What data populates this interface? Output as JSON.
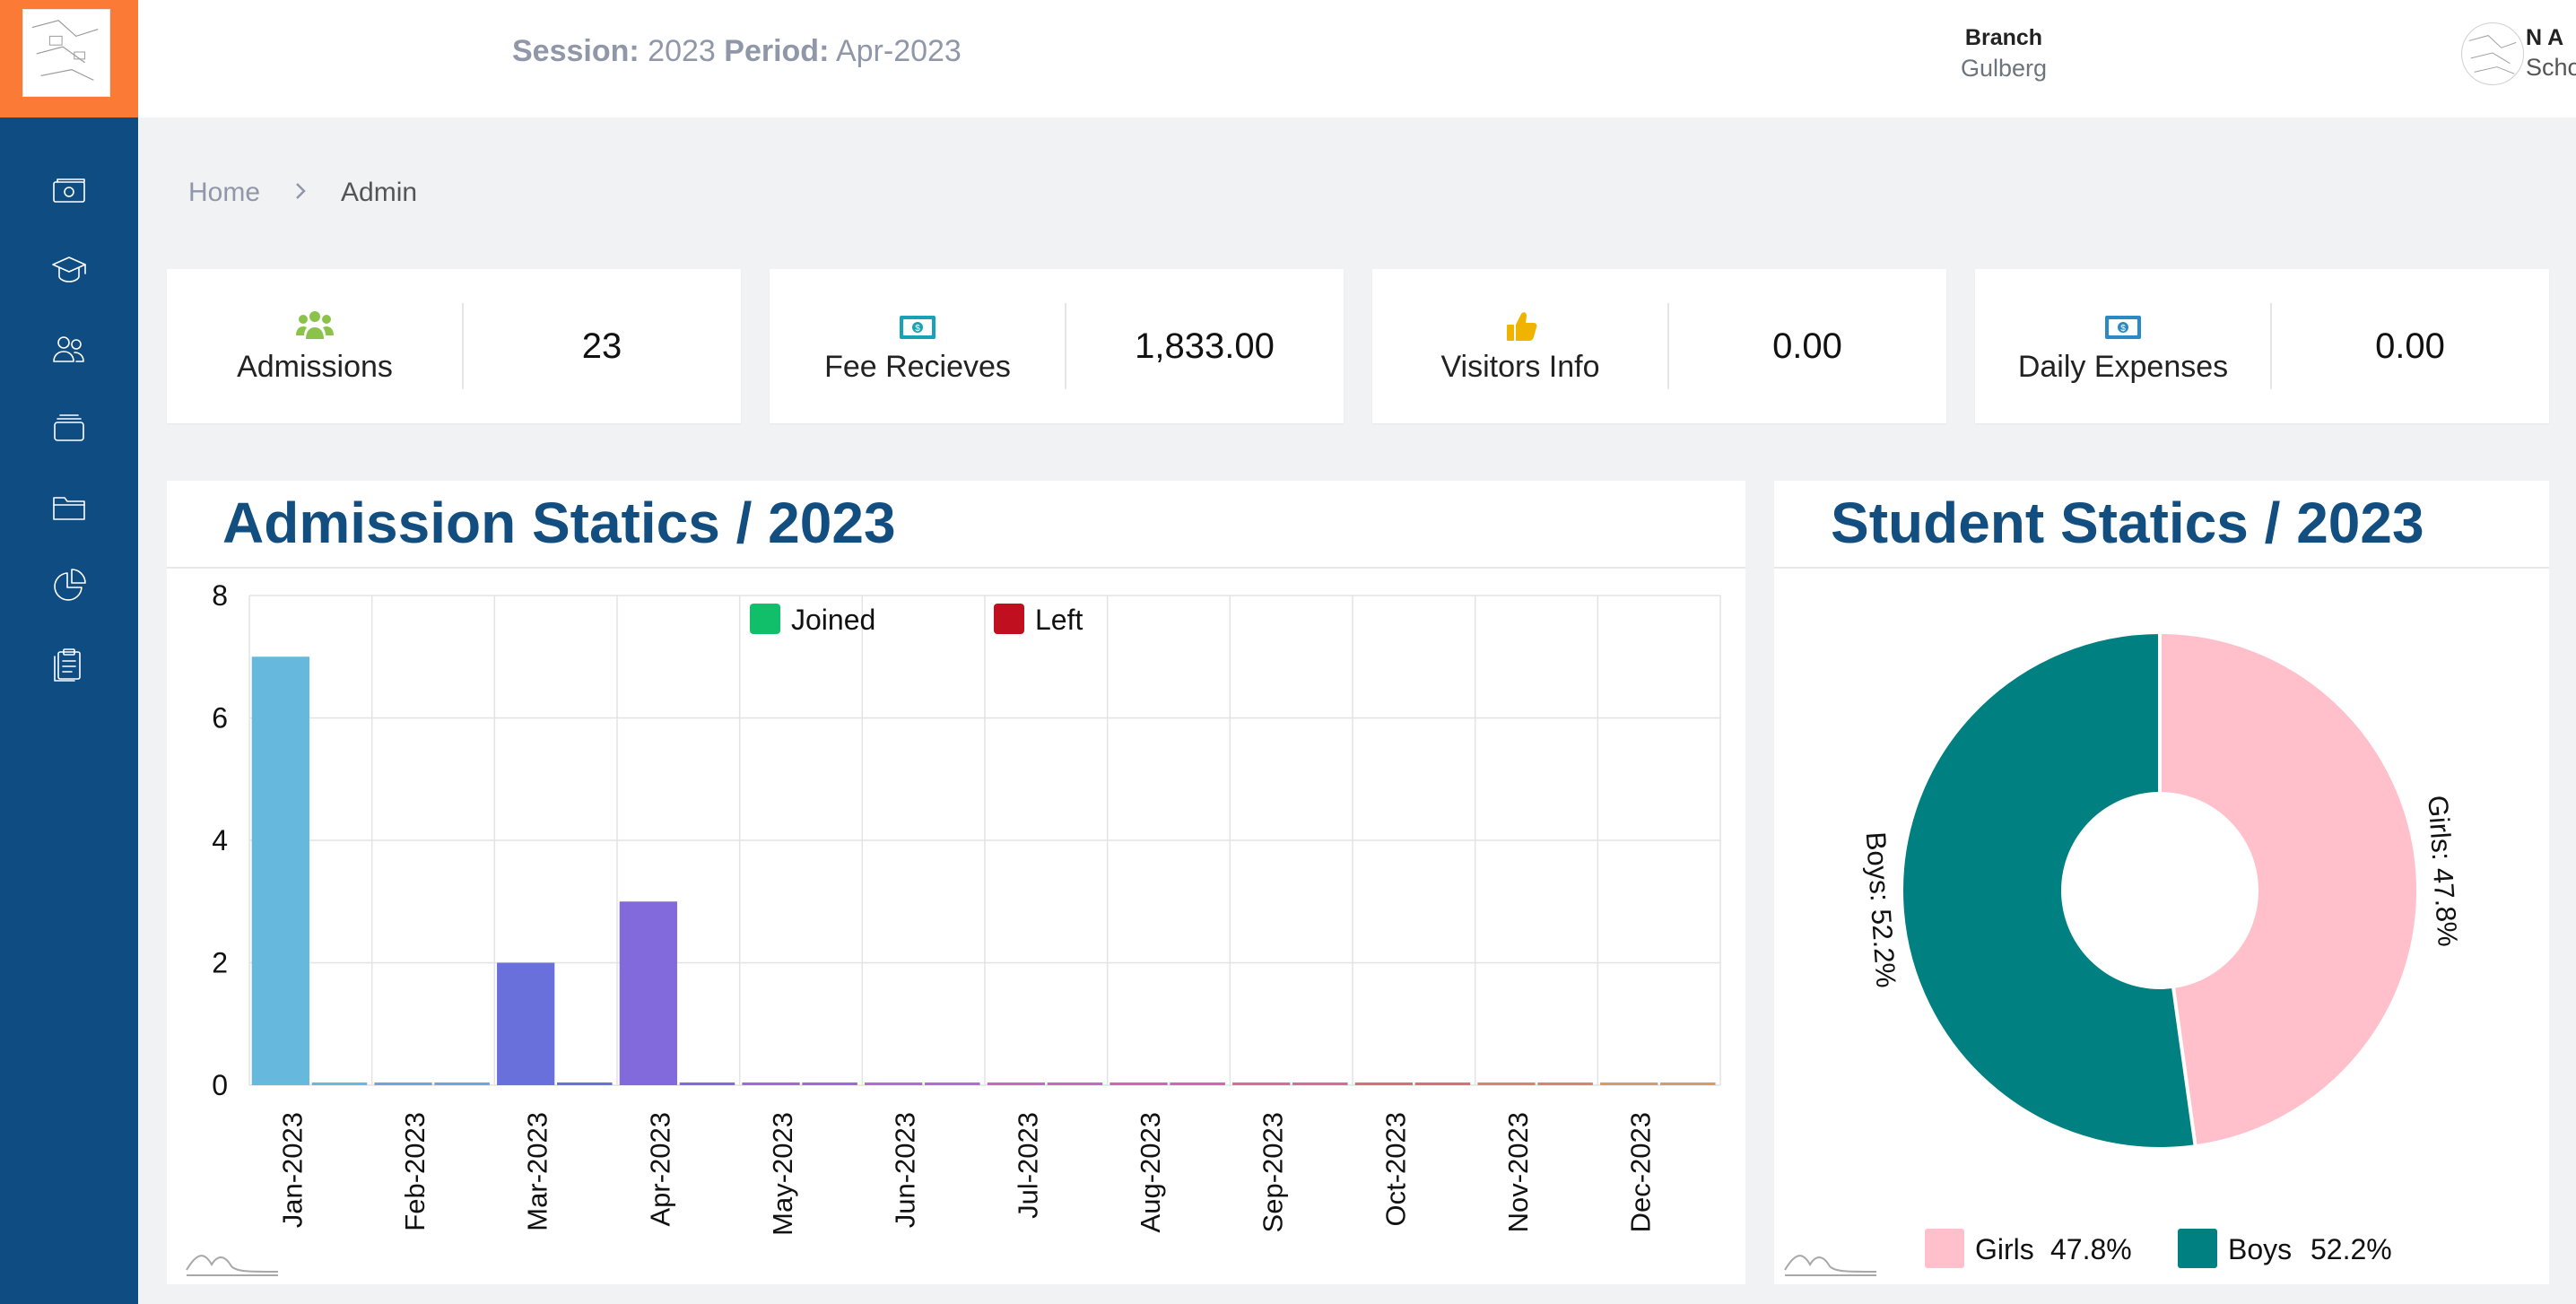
{
  "header": {
    "session_label": "Session:",
    "session_value": "2023",
    "period_label": "Period:",
    "period_value": "Apr-2023",
    "branch_label": "Branch",
    "branch_value": "Gulberg",
    "user_name": "N A",
    "user_role": "School Admin"
  },
  "sidebar": {
    "items": [
      {
        "icon": "money-icon"
      },
      {
        "icon": "graduation-cap-icon"
      },
      {
        "icon": "users-icon"
      },
      {
        "icon": "layers-icon"
      },
      {
        "icon": "folder-icon"
      },
      {
        "icon": "pie-chart-icon"
      },
      {
        "icon": "clipboard-icon"
      }
    ]
  },
  "breadcrumb": {
    "home": "Home",
    "current": "Admin"
  },
  "cards": [
    {
      "label": "Admissions",
      "value": "23",
      "icon": "users-icon",
      "color": "#8bc34a"
    },
    {
      "label": "Fee Recieves",
      "value": "1,833.00",
      "icon": "money-icon",
      "color": "#17a2b8"
    },
    {
      "label": "Visitors Info",
      "value": "0.00",
      "icon": "thumbs-up-icon",
      "color": "#f0b400"
    },
    {
      "label": "Daily Expenses",
      "value": "0.00",
      "icon": "money-icon",
      "color": "#2b8ac6"
    }
  ],
  "admission_chart": {
    "title": "Admission Statics / 2023"
  },
  "student_chart": {
    "title": "Student Statics / 2023"
  },
  "chart_data": [
    {
      "type": "bar",
      "title": "Admission Statics / 2023",
      "categories": [
        "Jan-2023",
        "Feb-2023",
        "Mar-2023",
        "Apr-2023",
        "May-2023",
        "Jun-2023",
        "Jul-2023",
        "Aug-2023",
        "Sep-2023",
        "Oct-2023",
        "Nov-2023",
        "Dec-2023"
      ],
      "series": [
        {
          "name": "Joined",
          "values": [
            7,
            0,
            2,
            3,
            0,
            0,
            0,
            0,
            0,
            0,
            0,
            0
          ],
          "color": "#11bf6a"
        },
        {
          "name": "Left",
          "values": [
            0,
            0,
            0,
            0,
            0,
            0,
            0,
            0,
            0,
            0,
            0,
            0
          ],
          "color": "#c0101f"
        }
      ],
      "bar_colors": [
        "#66b8dc",
        "#67a6e0",
        "#6970dc",
        "#8269dc",
        "#9c6bd9",
        "#b26ad6",
        "#c867c8",
        "#d166ae",
        "#d86a98",
        "#d86e7c",
        "#d9836e",
        "#d69b6a"
      ],
      "yticks": [
        0,
        2,
        4,
        6,
        8
      ],
      "ylim": [
        0,
        8
      ],
      "legend": "top",
      "grid": true
    },
    {
      "type": "pie",
      "title": "Student Statics / 2023",
      "labels": [
        "Girls",
        "Boys"
      ],
      "values": [
        47.8,
        52.2
      ],
      "value_labels": [
        "Girls: 47.8%",
        "Boys: 52.2%"
      ],
      "legend_values": [
        "47.8%",
        "52.2%"
      ],
      "colors": [
        "#ffc0cb",
        "#008080"
      ],
      "legend": "bottom"
    }
  ]
}
